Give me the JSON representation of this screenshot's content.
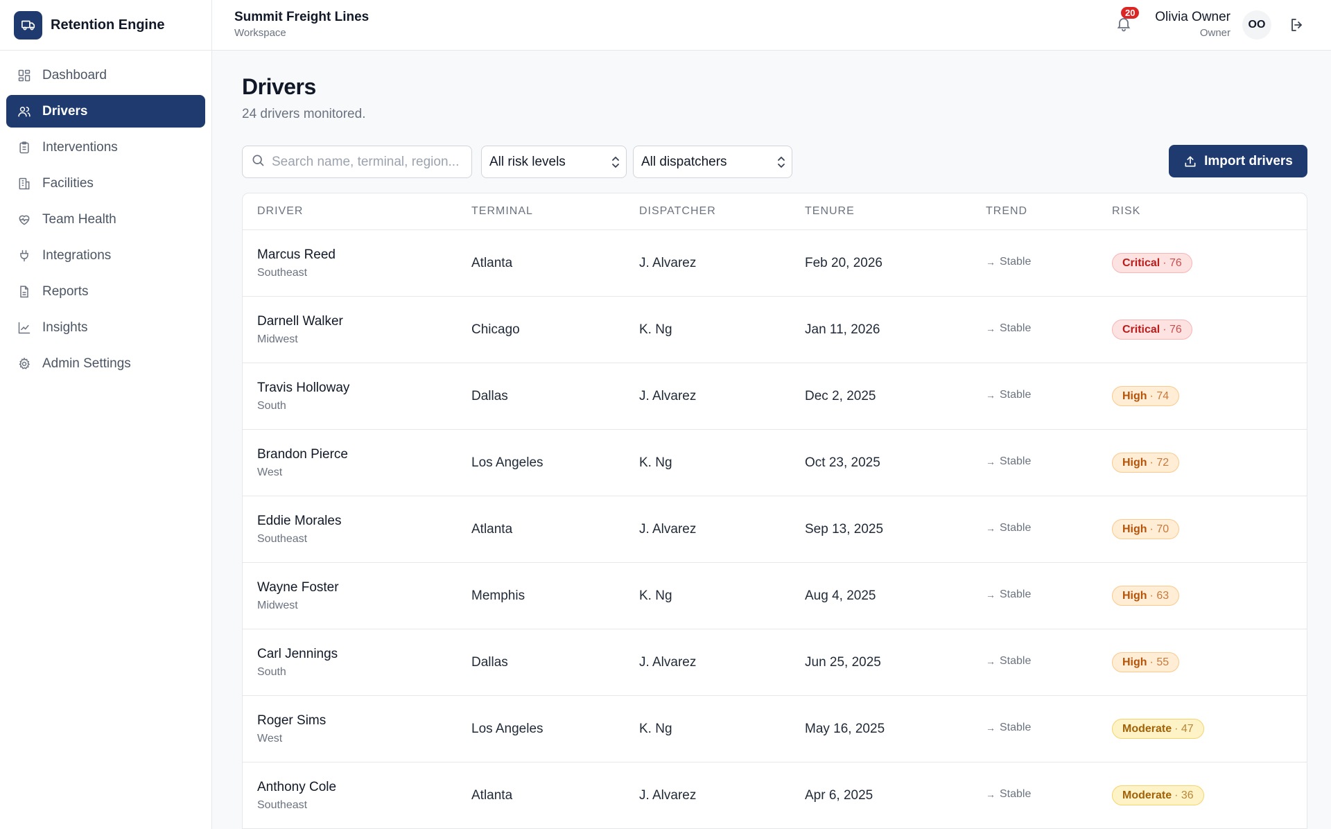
{
  "brand": {
    "name": "Retention Engine"
  },
  "sidebar": {
    "items": [
      {
        "label": "Dashboard",
        "icon": "dashboard-icon",
        "active": false
      },
      {
        "label": "Drivers",
        "icon": "users-icon",
        "active": true
      },
      {
        "label": "Interventions",
        "icon": "clipboard-icon",
        "active": false
      },
      {
        "label": "Facilities",
        "icon": "building-icon",
        "active": false
      },
      {
        "label": "Team Health",
        "icon": "heart-pulse-icon",
        "active": false
      },
      {
        "label": "Integrations",
        "icon": "plug-icon",
        "active": false
      },
      {
        "label": "Reports",
        "icon": "file-icon",
        "active": false
      },
      {
        "label": "Insights",
        "icon": "line-chart-icon",
        "active": false
      },
      {
        "label": "Admin Settings",
        "icon": "gear-icon",
        "active": false
      }
    ]
  },
  "header": {
    "workspace_name": "Summit Freight Lines",
    "workspace_label": "Workspace",
    "notification_count": "20",
    "user_name": "Olivia Owner",
    "user_role": "Owner",
    "avatar_initials": "OO"
  },
  "page": {
    "title": "Drivers",
    "subtitle": "24 drivers monitored."
  },
  "filters": {
    "search_placeholder": "Search name, terminal, region...",
    "risk_select": "All risk levels",
    "dispatcher_select": "All dispatchers",
    "import_label": "Import drivers"
  },
  "table": {
    "columns": [
      "DRIVER",
      "TERMINAL",
      "DISPATCHER",
      "TENURE",
      "TREND",
      "RISK"
    ],
    "rows": [
      {
        "name": "Marcus Reed",
        "region": "Southeast",
        "terminal": "Atlanta",
        "dispatcher": "J. Alvarez",
        "tenure": "Feb 20, 2026",
        "trend": "Stable",
        "risk_level": "Critical",
        "risk_score": "· 76",
        "risk_class": "critical"
      },
      {
        "name": "Darnell Walker",
        "region": "Midwest",
        "terminal": "Chicago",
        "dispatcher": "K. Ng",
        "tenure": "Jan 11, 2026",
        "trend": "Stable",
        "risk_level": "Critical",
        "risk_score": "· 76",
        "risk_class": "critical"
      },
      {
        "name": "Travis Holloway",
        "region": "South",
        "terminal": "Dallas",
        "dispatcher": "J. Alvarez",
        "tenure": "Dec 2, 2025",
        "trend": "Stable",
        "risk_level": "High",
        "risk_score": "· 74",
        "risk_class": "high"
      },
      {
        "name": "Brandon Pierce",
        "region": "West",
        "terminal": "Los Angeles",
        "dispatcher": "K. Ng",
        "tenure": "Oct 23, 2025",
        "trend": "Stable",
        "risk_level": "High",
        "risk_score": "· 72",
        "risk_class": "high"
      },
      {
        "name": "Eddie Morales",
        "region": "Southeast",
        "terminal": "Atlanta",
        "dispatcher": "J. Alvarez",
        "tenure": "Sep 13, 2025",
        "trend": "Stable",
        "risk_level": "High",
        "risk_score": "· 70",
        "risk_class": "high"
      },
      {
        "name": "Wayne Foster",
        "region": "Midwest",
        "terminal": "Memphis",
        "dispatcher": "K. Ng",
        "tenure": "Aug 4, 2025",
        "trend": "Stable",
        "risk_level": "High",
        "risk_score": "· 63",
        "risk_class": "high"
      },
      {
        "name": "Carl Jennings",
        "region": "South",
        "terminal": "Dallas",
        "dispatcher": "J. Alvarez",
        "tenure": "Jun 25, 2025",
        "trend": "Stable",
        "risk_level": "High",
        "risk_score": "· 55",
        "risk_class": "high"
      },
      {
        "name": "Roger Sims",
        "region": "West",
        "terminal": "Los Angeles",
        "dispatcher": "K. Ng",
        "tenure": "May 16, 2025",
        "trend": "Stable",
        "risk_level": "Moderate",
        "risk_score": "· 47",
        "risk_class": "moderate"
      },
      {
        "name": "Anthony Cole",
        "region": "Southeast",
        "terminal": "Atlanta",
        "dispatcher": "J. Alvarez",
        "tenure": "Apr 6, 2025",
        "trend": "Stable",
        "risk_level": "Moderate",
        "risk_score": "· 36",
        "risk_class": "moderate"
      }
    ]
  },
  "colors": {
    "brand_navy": "#1e3a6e",
    "critical": "#b91c1c",
    "high": "#b45309",
    "moderate": "#a16207",
    "notification_badge": "#dc2626"
  }
}
